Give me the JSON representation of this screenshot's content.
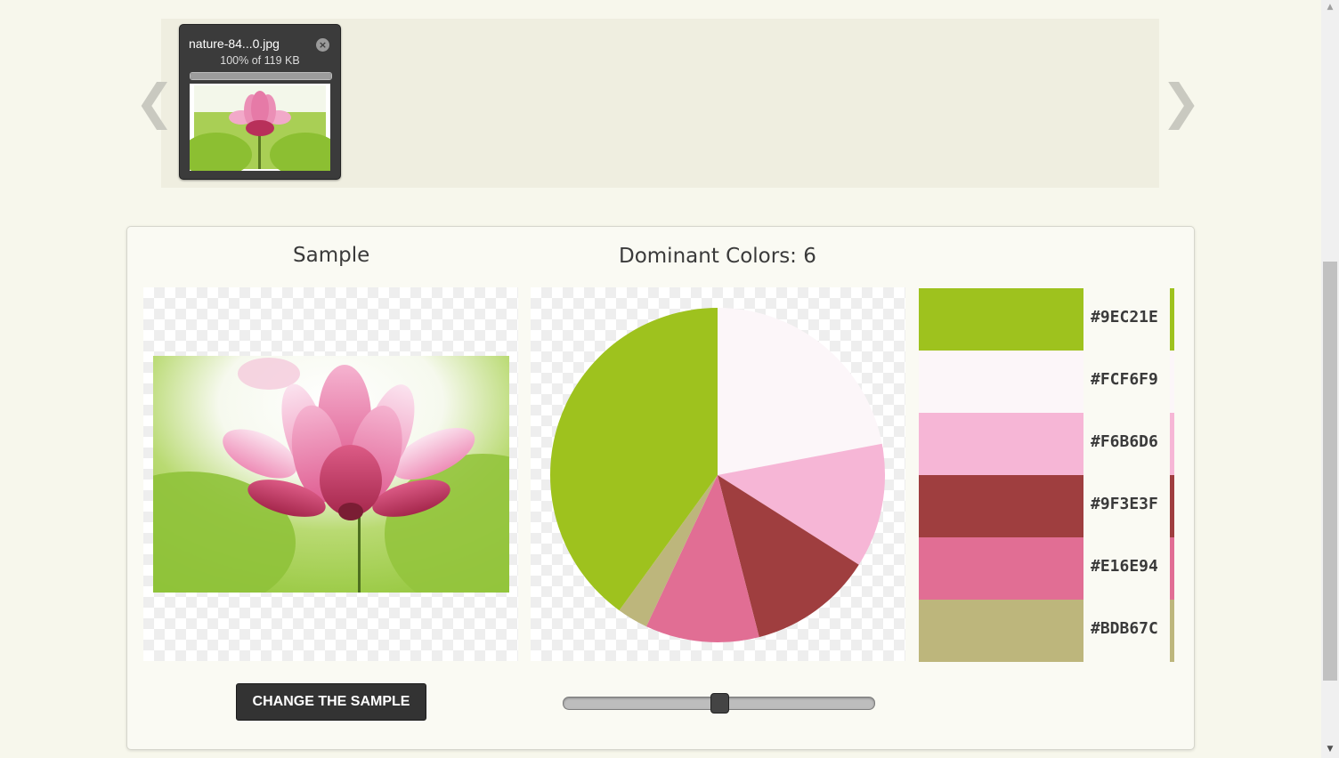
{
  "upload": {
    "file_name": "nature-84...0.jpg",
    "progress_text": "100% of 119 KB",
    "progress_fraction": 1.0,
    "prev_label": "❮",
    "next_label": "❯",
    "close_glyph": "×"
  },
  "sample": {
    "title": "Sample",
    "button_label": "CHANGE THE SAMPLE"
  },
  "dominant": {
    "title": "Dominant Colors: 6",
    "slider_fraction": 0.5
  },
  "chart_data": {
    "type": "pie",
    "title": "",
    "values": [
      22,
      12,
      12,
      11,
      3,
      40
    ],
    "labels": [
      "#FCF6F9",
      "#F6B6D6",
      "#9F3E3F",
      "#E16E94",
      "#BDB67C",
      "#9EC21E"
    ],
    "colors": [
      "#FCF6F9",
      "#F6B6D6",
      "#9F3E3F",
      "#E16E94",
      "#BDB67C",
      "#9EC21E"
    ]
  },
  "swatches": [
    {
      "hex": "#9EC21E",
      "color": "#9EC21E"
    },
    {
      "hex": "#FCF6F9",
      "color": "#FCF6F9"
    },
    {
      "hex": "#F6B6D6",
      "color": "#F6B6D6"
    },
    {
      "hex": "#9F3E3F",
      "color": "#9F3E3F"
    },
    {
      "hex": "#E16E94",
      "color": "#E16E94"
    },
    {
      "hex": "#BDB67C",
      "color": "#BDB67C"
    }
  ],
  "scrollbar": {
    "up_glyph": "▲",
    "down_glyph": "▼"
  }
}
